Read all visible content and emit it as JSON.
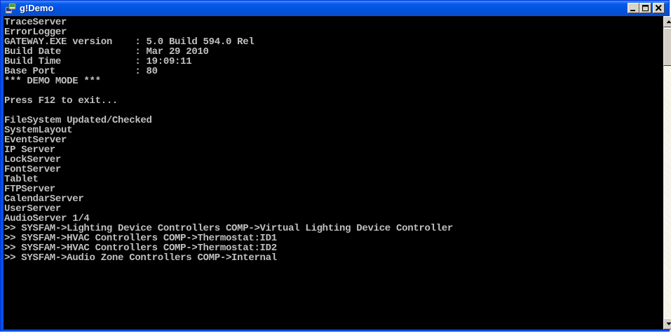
{
  "window": {
    "title": "g!Demo",
    "icons": {
      "app": "console-app-icon",
      "minimize": "minimize-icon",
      "restore": "restore-icon",
      "close": "close-icon"
    },
    "colors": {
      "titlebar": "#0054e3",
      "console_bg": "#000000",
      "console_text": "#c0c0c0"
    }
  },
  "console": {
    "lines": [
      "TraceServer",
      "ErrorLogger",
      "GATEWAY.EXE version    : 5.0 Build 594.0 Rel",
      "Build Date             : Mar 29 2010",
      "Build Time             : 19:09:11",
      "Base Port              : 80",
      "*** DEMO MODE ***",
      "",
      "Press F12 to exit...",
      "",
      "FileSystem Updated/Checked",
      "SystemLayout",
      "EventServer",
      "IP Server",
      "LockServer",
      "FontServer",
      "Tablet",
      "FTPServer",
      "CalendarServer",
      "UserServer",
      "AudioServer 1/4",
      ">> SYSFAM->Lighting Device Controllers COMP->Virtual Lighting Device Controller",
      ">> SYSFAM->HVAC Controllers COMP->Thermostat:ID1",
      ">> SYSFAM->HVAC Controllers COMP->Thermostat:ID2",
      ">> SYSFAM->Audio Zone Controllers COMP->Internal"
    ]
  },
  "scrollbar": {
    "up_icon": "scroll-up-arrow-icon",
    "down_icon": "scroll-down-arrow-icon"
  }
}
